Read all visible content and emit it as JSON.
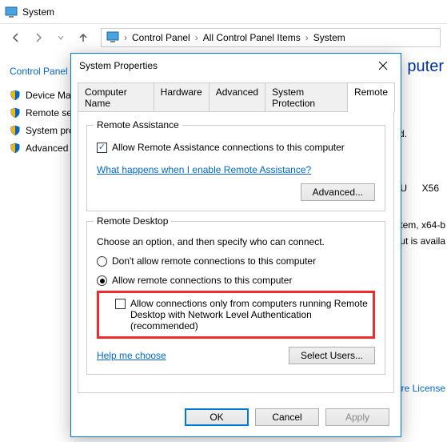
{
  "window": {
    "title": "System"
  },
  "breadcrumb": {
    "l1": "Control Panel",
    "l2": "All Control Panel Items",
    "l3": "System"
  },
  "sidepanel": {
    "home": "Control Panel H",
    "items": [
      {
        "label": "Device Ma"
      },
      {
        "label": "Remote se"
      },
      {
        "label": "System pro"
      },
      {
        "label": "Advanced"
      }
    ]
  },
  "background": {
    "puter": "puter",
    "d": "d.",
    "u": "U",
    "x56": "X56",
    "stem": "stem, x64-b",
    "avail": "ut is availa",
    "link": "are License"
  },
  "dialog": {
    "title": "System Properties",
    "tabs": {
      "computer_name": "Computer Name",
      "hardware": "Hardware",
      "advanced": "Advanced",
      "system_protection": "System Protection",
      "remote": "Remote"
    },
    "remote_assist": {
      "legend": "Remote Assistance",
      "allow_label": "Allow Remote Assistance connections to this computer",
      "what_link": "What happens when I enable Remote Assistance?",
      "advanced_btn": "Advanced..."
    },
    "remote_desktop": {
      "legend": "Remote Desktop",
      "choose_text": "Choose an option, and then specify who can connect.",
      "opt_dont": "Don't allow remote connections to this computer",
      "opt_allow": "Allow remote connections to this computer",
      "nla_label": "Allow connections only from computers running Remote Desktop with Network Level Authentication (recommended)",
      "help_link": "Help me choose",
      "select_users_btn": "Select Users..."
    },
    "buttons": {
      "ok": "OK",
      "cancel": "Cancel",
      "apply": "Apply"
    }
  }
}
